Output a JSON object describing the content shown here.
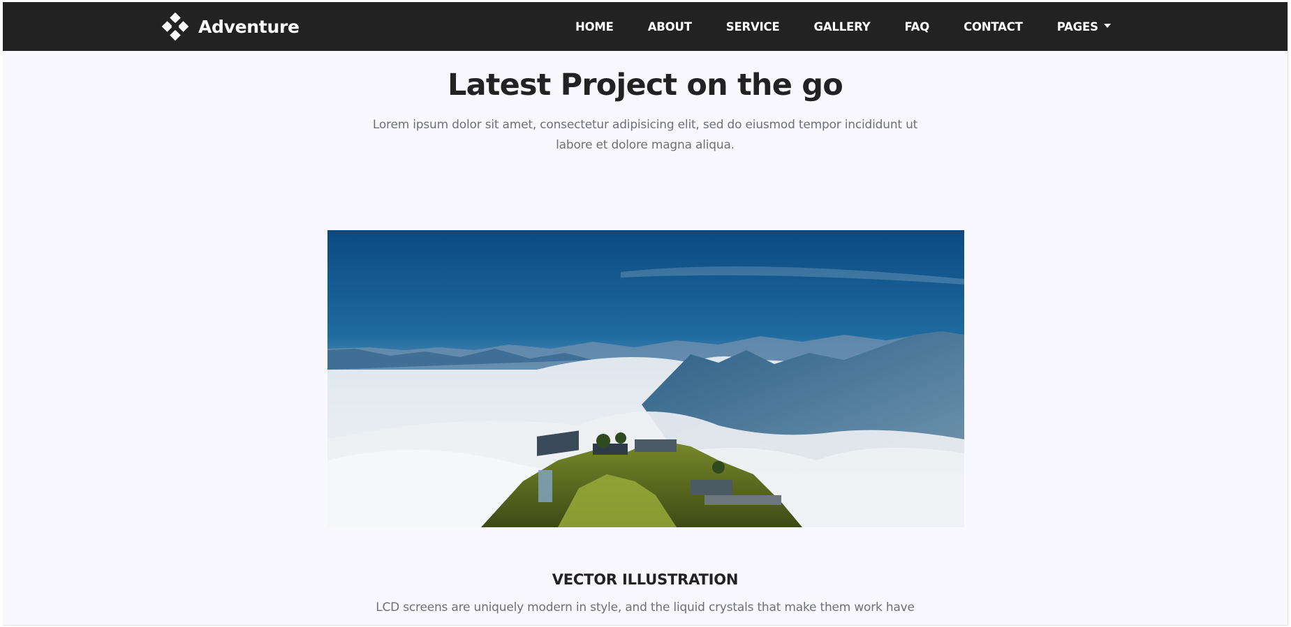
{
  "brand": {
    "name": "Adventure",
    "icon": "diamond-cluster-logo-icon"
  },
  "nav": {
    "items": [
      {
        "label": "HOME"
      },
      {
        "label": "ABOUT"
      },
      {
        "label": "SERVICE"
      },
      {
        "label": "GALLERY"
      },
      {
        "label": "FAQ"
      },
      {
        "label": "CONTACT"
      },
      {
        "label": "PAGES",
        "icon": "caret-down-icon"
      }
    ]
  },
  "section": {
    "title": "Latest Project on the go",
    "subtitle": "Lorem ipsum dolor sit amet, consectetur adipisicing elit, sed do eiusmod tempor incididunt ut labore et dolore magna aliqua."
  },
  "project": {
    "title": "VECTOR ILLUSTRATION",
    "text": "LCD screens are uniquely modern in style, and the liquid crystals that make them work have"
  },
  "colors": {
    "navbar": "#222222",
    "page_background": "#f8f8fe",
    "heading": "#222222",
    "body_text": "#6f6f78"
  }
}
